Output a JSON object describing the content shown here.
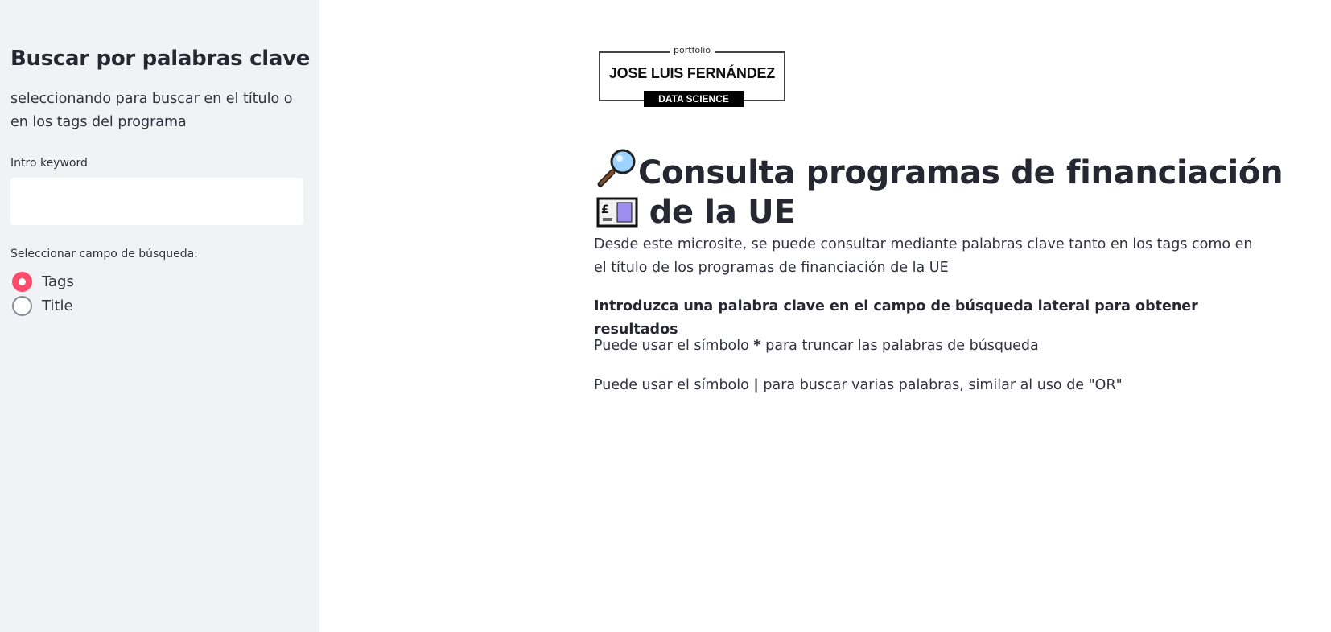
{
  "sidebar": {
    "title": "Buscar por palabras clave",
    "description": "seleccionando para buscar en el título o en los tags del programa",
    "keyword_label": "Intro keyword",
    "keyword_value": "",
    "keyword_placeholder": "",
    "field_label": "Seleccionar campo de búsqueda:",
    "radio_options": [
      {
        "label": "Tags",
        "checked": true
      },
      {
        "label": "Title",
        "checked": false
      }
    ]
  },
  "logo": {
    "small_text": "portfolio",
    "name": "JOSE LUIS FERNÁNDEZ",
    "tag": "DATA SCIENCE"
  },
  "main": {
    "heading_line1": "Consulta programas de financiación",
    "heading_line2": "de la UE",
    "intro": "Desde este microsite, se puede consultar mediante palabras clave tanto en los tags como en el título de los programas de financiación de la UE",
    "instruction": "Introduzca una palabra clave en el campo de búsqueda lateral para obtener resultados",
    "tip1_before": "Puede usar el símbolo ",
    "tip1_symbol": "*",
    "tip1_after": " para truncar las palabras de búsqueda",
    "tip2_before": "Puede usar el símbolo ",
    "tip2_symbol": "|",
    "tip2_after": " para buscar varias palabras, similar al uso de \"OR\""
  },
  "icons": {
    "heading_icon_1": "magnifying-glass-icon",
    "heading_icon_2": "pound-banknote-icon"
  },
  "colors": {
    "sidebar_bg": "#f0f2f6",
    "accent": "#ff4b6b",
    "text": "#262730"
  }
}
